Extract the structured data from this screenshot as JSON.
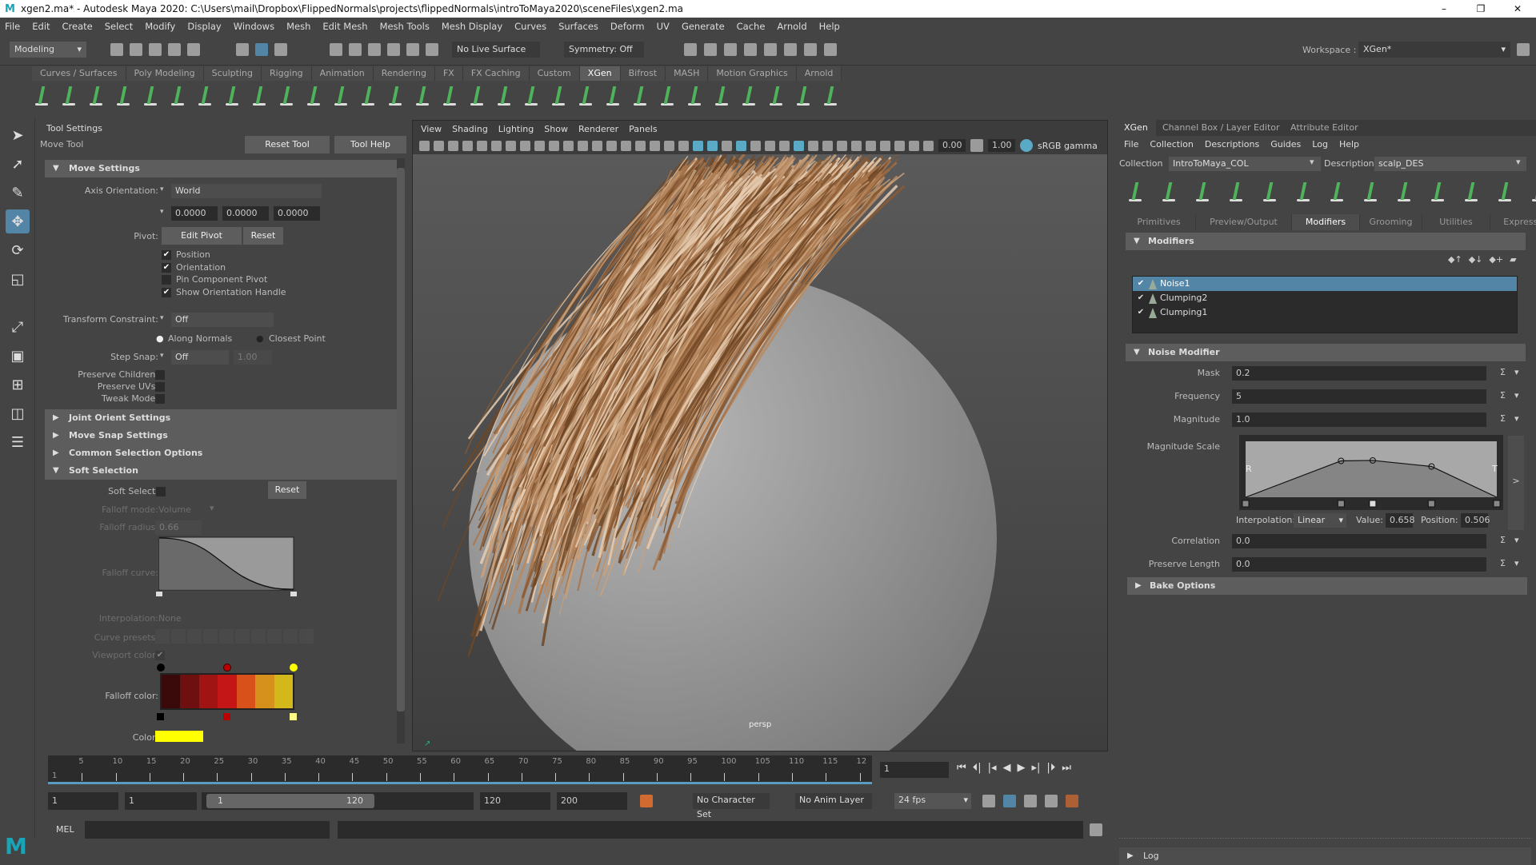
{
  "title_bar": {
    "title": "xgen2.ma* - Autodesk Maya 2020: C:\\Users\\mail\\Dropbox\\FlippedNormals\\projects\\flippedNormals\\introToMaya2020\\sceneFiles\\xgen2.ma",
    "minimize": "–",
    "maximize": "❐",
    "close": "✕"
  },
  "menu": [
    "File",
    "Edit",
    "Create",
    "Select",
    "Modify",
    "Display",
    "Windows",
    "Mesh",
    "Edit Mesh",
    "Mesh Tools",
    "Mesh Display",
    "Curves",
    "Surfaces",
    "Deform",
    "UV",
    "Generate",
    "Cache",
    "Arnold",
    "Help"
  ],
  "status_line": {
    "menu_set": "Modeling",
    "live_surface": "No Live Surface",
    "symmetry": "Symmetry: Off",
    "workspace_label": "Workspace :",
    "workspace": "XGen*"
  },
  "shelf": {
    "tabs": [
      "Curves / Surfaces",
      "Poly Modeling",
      "Sculpting",
      "Rigging",
      "Animation",
      "Rendering",
      "FX",
      "FX Caching",
      "Custom",
      "XGen",
      "Bifrost",
      "MASH",
      "Motion Graphics",
      "Arnold"
    ],
    "active": "XGen"
  },
  "tool_settings": {
    "panel_title": "Tool Settings",
    "tool_name": "Move Tool",
    "reset_tool": "Reset Tool",
    "tool_help": "Tool Help",
    "move_settings": "Move Settings",
    "axis_orientation_label": "Axis Orientation:",
    "axis_orientation": "World",
    "axis_values": [
      "0.0000",
      "0.0000",
      "0.0000"
    ],
    "pivot_label": "Pivot:",
    "edit_pivot": "Edit Pivot",
    "pivot_reset": "Reset",
    "pivot_options": [
      {
        "label": "Position",
        "checked": true
      },
      {
        "label": "Orientation",
        "checked": true
      },
      {
        "label": "Pin Component Pivot",
        "checked": false
      },
      {
        "label": "Show Orientation Handle",
        "checked": true
      }
    ],
    "transform_constraint_label": "Transform Constraint:",
    "transform_constraint": "Off",
    "along_normals": "Along Normals",
    "closest_point": "Closest Point",
    "step_snap_label": "Step Snap:",
    "step_snap": "Off",
    "step_snap_value": "1.00",
    "preserve_children": "Preserve Children:",
    "preserve_uvs": "Preserve UVs:",
    "tweak_mode": "Tweak Mode:",
    "sections": [
      "Joint Orient Settings",
      "Move Snap Settings",
      "Common Selection Options"
    ],
    "soft_selection": "Soft Selection",
    "soft_select_label": "Soft Select:",
    "soft_reset": "Reset",
    "falloff_mode_label": "Falloff mode:",
    "falloff_mode": "Volume",
    "falloff_radius_label": "Falloff radius:",
    "falloff_radius": "0.66",
    "falloff_curve_label": "Falloff curve:",
    "interpolation_label": "Interpolation:",
    "interpolation": "None",
    "curve_presets_label": "Curve presets:",
    "viewport_color_label": "Viewport color:",
    "falloff_color_label": "Falloff color:",
    "falloff_colors": [
      "#3a0a0a",
      "#6e1010",
      "#a01414",
      "#c41616",
      "#d8501a",
      "#d6901c",
      "#d2b81a"
    ],
    "color_label": "Color:",
    "color": "#ffff00"
  },
  "viewport": {
    "menu": [
      "View",
      "Shading",
      "Lighting",
      "Show",
      "Renderer",
      "Panels"
    ],
    "exposure": "0.00",
    "gamma": "1.00",
    "color_space": "sRGB gamma",
    "camera": "persp"
  },
  "xgen": {
    "tabs": [
      "XGen",
      "Channel Box / Layer Editor",
      "Attribute Editor"
    ],
    "menu": [
      "File",
      "Collection",
      "Descriptions",
      "Guides",
      "Log",
      "Help"
    ],
    "collection_label": "Collection",
    "collection": "IntroToMaya_COL",
    "description_label": "Description",
    "description": "scalp_DES",
    "subtabs": [
      "Primitives",
      "Preview/Output",
      "Modifiers",
      "Grooming",
      "Utilities",
      "Expressions"
    ],
    "active_subtab": "Modifiers",
    "modifiers_header": "Modifiers",
    "modifiers": [
      {
        "name": "Noise1",
        "checked": true,
        "selected": true
      },
      {
        "name": "Clumping2",
        "checked": true,
        "selected": false
      },
      {
        "name": "Clumping1",
        "checked": true,
        "selected": false
      }
    ],
    "noise_header": "Noise Modifier",
    "fields": [
      {
        "label": "Mask",
        "value": "0.2"
      },
      {
        "label": "Frequency",
        "value": "5"
      },
      {
        "label": "Magnitude",
        "value": "1.0"
      }
    ],
    "magnitude_scale_label": "Magnitude Scale",
    "ramp_left": "R",
    "ramp_right": "T",
    "ramp_expand": ">",
    "ramp_points": [
      [
        0,
        0
      ],
      [
        0.38,
        0.65
      ],
      [
        0.506,
        0.658
      ],
      [
        0.74,
        0.55
      ],
      [
        1,
        0
      ]
    ],
    "interpolation_label": "Interpolation:",
    "interpolation": "Linear",
    "value_label": "Value:",
    "value": "0.658",
    "position_label": "Position:",
    "position": "0.506",
    "fields2": [
      {
        "label": "Correlation",
        "value": "0.0"
      },
      {
        "label": "Preserve Length",
        "value": "0.0"
      }
    ],
    "bake_options": "Bake Options",
    "log": "Log"
  },
  "timeline": {
    "ticks": [
      "5",
      "10",
      "15",
      "20",
      "25",
      "30",
      "35",
      "40",
      "45",
      "50",
      "55",
      "60",
      "65",
      "70",
      "75",
      "80",
      "85",
      "90",
      "95",
      "100",
      "105",
      "110",
      "115",
      "12"
    ],
    "current_frame": "1",
    "start_label": "1"
  },
  "range": {
    "start": "1",
    "playback_start": "1",
    "slider_start": "1",
    "slider_end": "120",
    "playback_end": "120",
    "end": "200",
    "character_set": "No Character Set",
    "anim_layer": "No Anim Layer",
    "fps": "24 fps"
  },
  "command_line": {
    "mode": "MEL"
  },
  "accent": "#5285a6"
}
